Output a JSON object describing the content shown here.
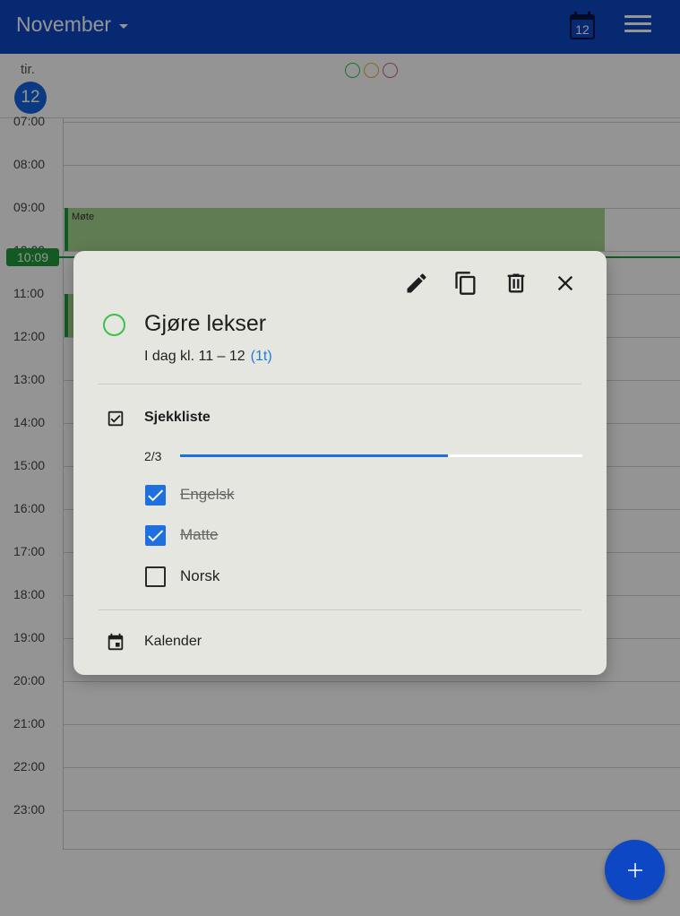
{
  "header": {
    "month_label": "November",
    "today_icon_number": "12",
    "accent_color": "#0d47c4"
  },
  "day_header": {
    "weekday": "tir.",
    "day_number": "12",
    "status_dots": [
      {
        "name": "green-dot",
        "color": "#39c14a"
      },
      {
        "name": "yellow-dot",
        "color": "#e8b52a"
      },
      {
        "name": "pink-dot",
        "color": "#e05a8a"
      }
    ]
  },
  "hours": [
    "07:00",
    "08:00",
    "09:00",
    "10:00",
    "11:00",
    "12:00",
    "13:00",
    "14:00",
    "15:00",
    "16:00",
    "17:00",
    "18:00",
    "19:00",
    "20:00",
    "21:00",
    "22:00",
    "23:00"
  ],
  "events": [
    {
      "title": "Møte",
      "start": "09:00",
      "end": "10:00"
    },
    {
      "title": "",
      "start": "11:00",
      "end": "12:00"
    }
  ],
  "now_indicator": {
    "time": "10:09",
    "color": "#1f9a3c"
  },
  "dialog": {
    "title": "Gjøre lekser",
    "time_text": "I dag kl. 11 – 12",
    "duration": "(1t)",
    "actions": [
      "edit-icon",
      "copy-icon",
      "delete-icon",
      "close-icon"
    ],
    "checklist": {
      "label": "Sjekkliste",
      "progress_text": "2/3",
      "progress_fraction": 0.667,
      "items": [
        {
          "label": "Engelsk",
          "checked": true
        },
        {
          "label": "Matte",
          "checked": true
        },
        {
          "label": "Norsk",
          "checked": false
        }
      ]
    },
    "calendar_label": "Kalender"
  },
  "fab": {
    "icon": "plus-icon"
  }
}
